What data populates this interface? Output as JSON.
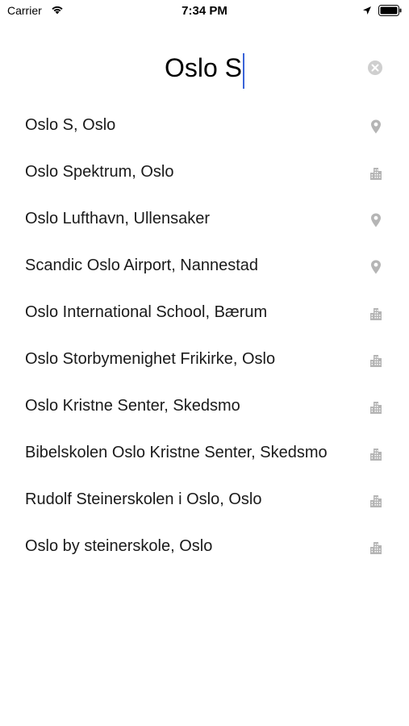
{
  "status_bar": {
    "carrier": "Carrier",
    "time": "7:34 PM",
    "icons": [
      "wifi-icon",
      "location-arrow-icon",
      "battery-icon"
    ]
  },
  "search": {
    "value": "Oslo S",
    "clear_icon": "clear-circle-icon",
    "caret_color": "#3a63d8"
  },
  "results": [
    {
      "label": "Oslo S, Oslo",
      "icon": "map-pin-icon"
    },
    {
      "label": "Oslo Spektrum, Oslo",
      "icon": "building-icon"
    },
    {
      "label": "Oslo Lufthavn, Ullensaker",
      "icon": "map-pin-icon"
    },
    {
      "label": "Scandic Oslo Airport, Nannestad",
      "icon": "map-pin-icon"
    },
    {
      "label": "Oslo International School, Bærum",
      "icon": "building-icon"
    },
    {
      "label": "Oslo Storbymenighet Frikirke, Oslo",
      "icon": "building-icon"
    },
    {
      "label": "Oslo Kristne Senter, Skedsmo",
      "icon": "building-icon"
    },
    {
      "label": "Bibelskolen Oslo Kristne Senter, Skedsmo",
      "icon": "building-icon"
    },
    {
      "label": "Rudolf Steinerskolen i Oslo, Oslo",
      "icon": "building-icon"
    },
    {
      "label": "Oslo by steinerskole, Oslo",
      "icon": "building-icon"
    }
  ],
  "colors": {
    "icon_gray": "#b5b5b5",
    "text": "#1a1a1a"
  }
}
